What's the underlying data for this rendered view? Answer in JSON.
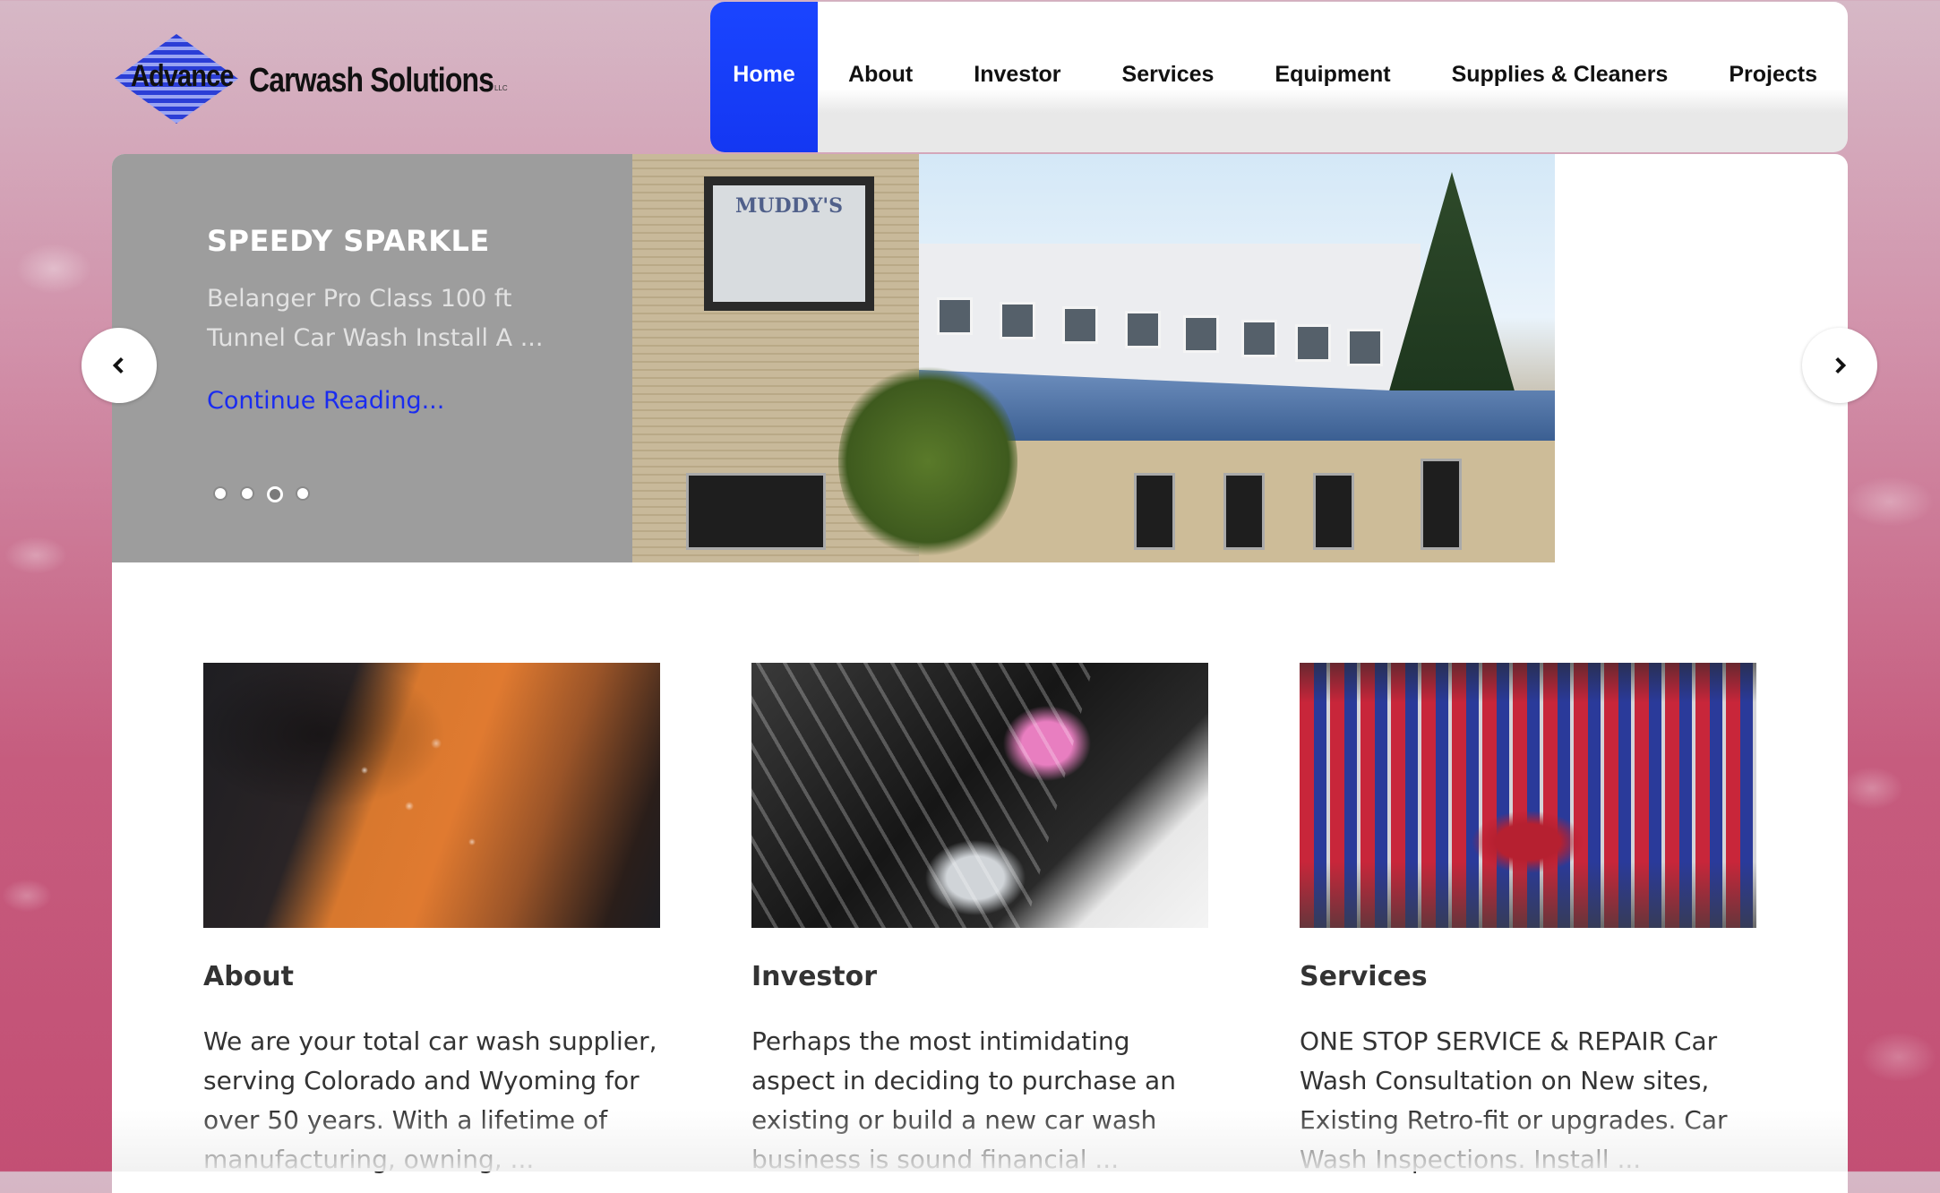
{
  "header": {
    "logo": {
      "word1": "Advance",
      "word2": "Carwash Solutions",
      "suffix": "LLC"
    }
  },
  "nav": {
    "items": [
      {
        "label": "Home",
        "active": true
      },
      {
        "label": "About"
      },
      {
        "label": "Investor"
      },
      {
        "label": "Services"
      },
      {
        "label": "Equipment"
      },
      {
        "label": "Supplies & Cleaners"
      },
      {
        "label": "Projects"
      }
    ]
  },
  "slider": {
    "title": "SPEEDY SPARKLE",
    "description": "Belanger Pro Class 100 ft Tunnel Car Wash Install A ...",
    "link": "Continue Reading...",
    "photo_sign": "MUDDY'S",
    "active_dot": 3,
    "dot_count": 4,
    "prev_icon": "chevron-left-icon",
    "next_icon": "chevron-right-icon"
  },
  "features": [
    {
      "title": "About",
      "text": "We are your total car wash supplier, serving Colorado and Wyoming for over 50 years. With a lifetime of manufacturing, owning, ..."
    },
    {
      "title": "Investor",
      "text": "Perhaps the most intimidating aspect in deciding to purchase an existing or build a new car wash business is sound financial ..."
    },
    {
      "title": "Services",
      "text": "ONE STOP SERVICE & REPAIR Car Wash Consultation on New sites, Existing Retro-fit or upgrades. Car Wash Inspections. Install ..."
    }
  ],
  "colors": {
    "accent": "#1437f2",
    "link": "#1a2cf0",
    "slider_panel": "#9d9d9d"
  }
}
